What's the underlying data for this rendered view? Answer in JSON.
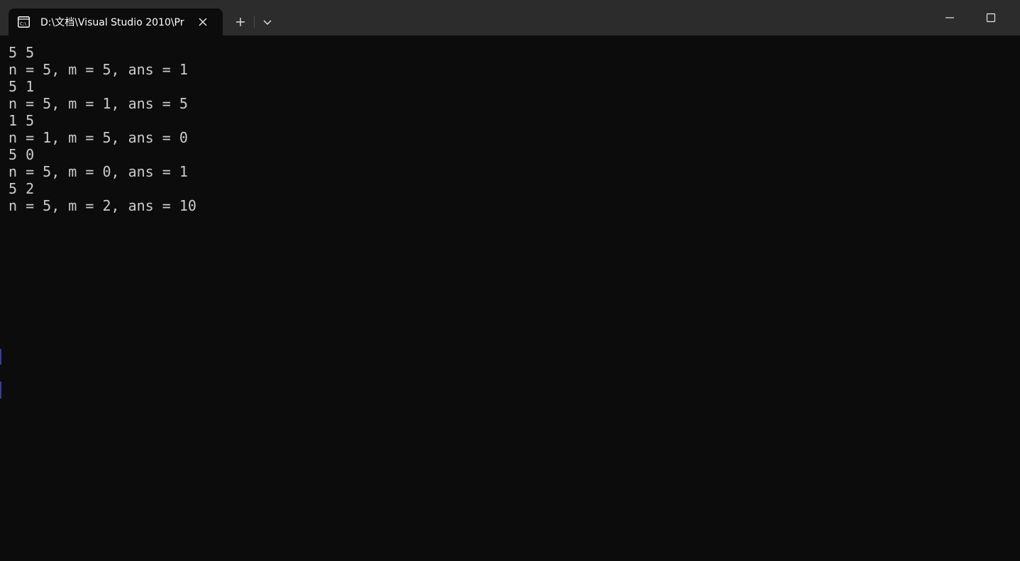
{
  "window": {
    "tab_title": "D:\\文档\\Visual Studio 2010\\Pr",
    "tab_icon": "console-icon",
    "close_icon": "close-icon",
    "new_tab_icon": "plus-icon",
    "dropdown_icon": "chevron-down-icon",
    "minimize_icon": "minimize-icon",
    "maximize_icon": "maximize-icon"
  },
  "terminal": {
    "lines": [
      "5 5",
      "n = 5, m = 5, ans = 1",
      "5 1",
      "n = 5, m = 1, ans = 5",
      "1 5",
      "n = 1, m = 5, ans = 0",
      "5 0",
      "n = 5, m = 0, ans = 1",
      "5 2",
      "n = 5, m = 2, ans = 10"
    ]
  },
  "colors": {
    "titlebar": "#2c2c2c",
    "background": "#0c0c0c",
    "text": "#cccccc",
    "tab_text": "#ffffff"
  }
}
